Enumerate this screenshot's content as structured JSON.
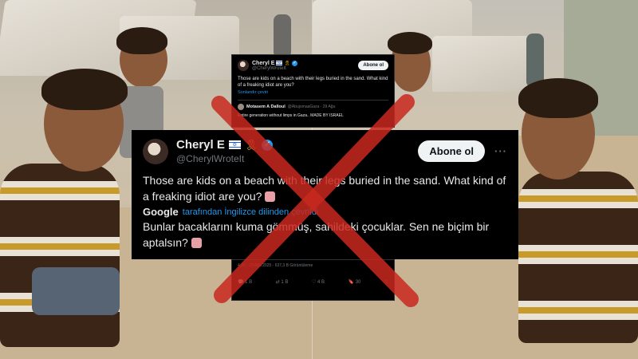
{
  "small_card": {
    "name": "Cheryl E",
    "handle": "@CherylWroteIt",
    "follow": "Abone ol",
    "text": "Those are kids on a beach with their legs buried in the sand. What kind of a freaking idiot are you?",
    "translate_link": "Sonlandır çeviri",
    "quote": {
      "name": "Motasem A Dalloul",
      "handle": "@AbujomaaGaza · 29 Ağu",
      "text": "Entire generation without limps in Gaza.. MADE BY ISRAEL"
    }
  },
  "main_card": {
    "name": "Cheryl E",
    "handle": "@CherylWroteIt",
    "follow": "Abone ol",
    "more": "···",
    "text": "Those are kids on a beach with their legs buried in the sand. What kind of a freaking idiot are you?",
    "google_label": "Google",
    "translated_by": "tarafından İngilizce dilinden çevrildi",
    "translated_text": "Bunlar bacaklarını kuma gömmüş, sahildeki çocuklar. Sen ne biçim bir aptalsın?"
  },
  "bottom_card": {
    "meta": "4:35 · 29 Ağu 2025 · 637,3 B Görüntüleme",
    "actions": {
      "replies": "1 B",
      "reposts": "1 B",
      "likes": "4 B",
      "bookmarks": "30"
    }
  },
  "colors": {
    "cross": "#c8281e",
    "verified": "#1d9bf0",
    "link": "#1d9bf0"
  }
}
